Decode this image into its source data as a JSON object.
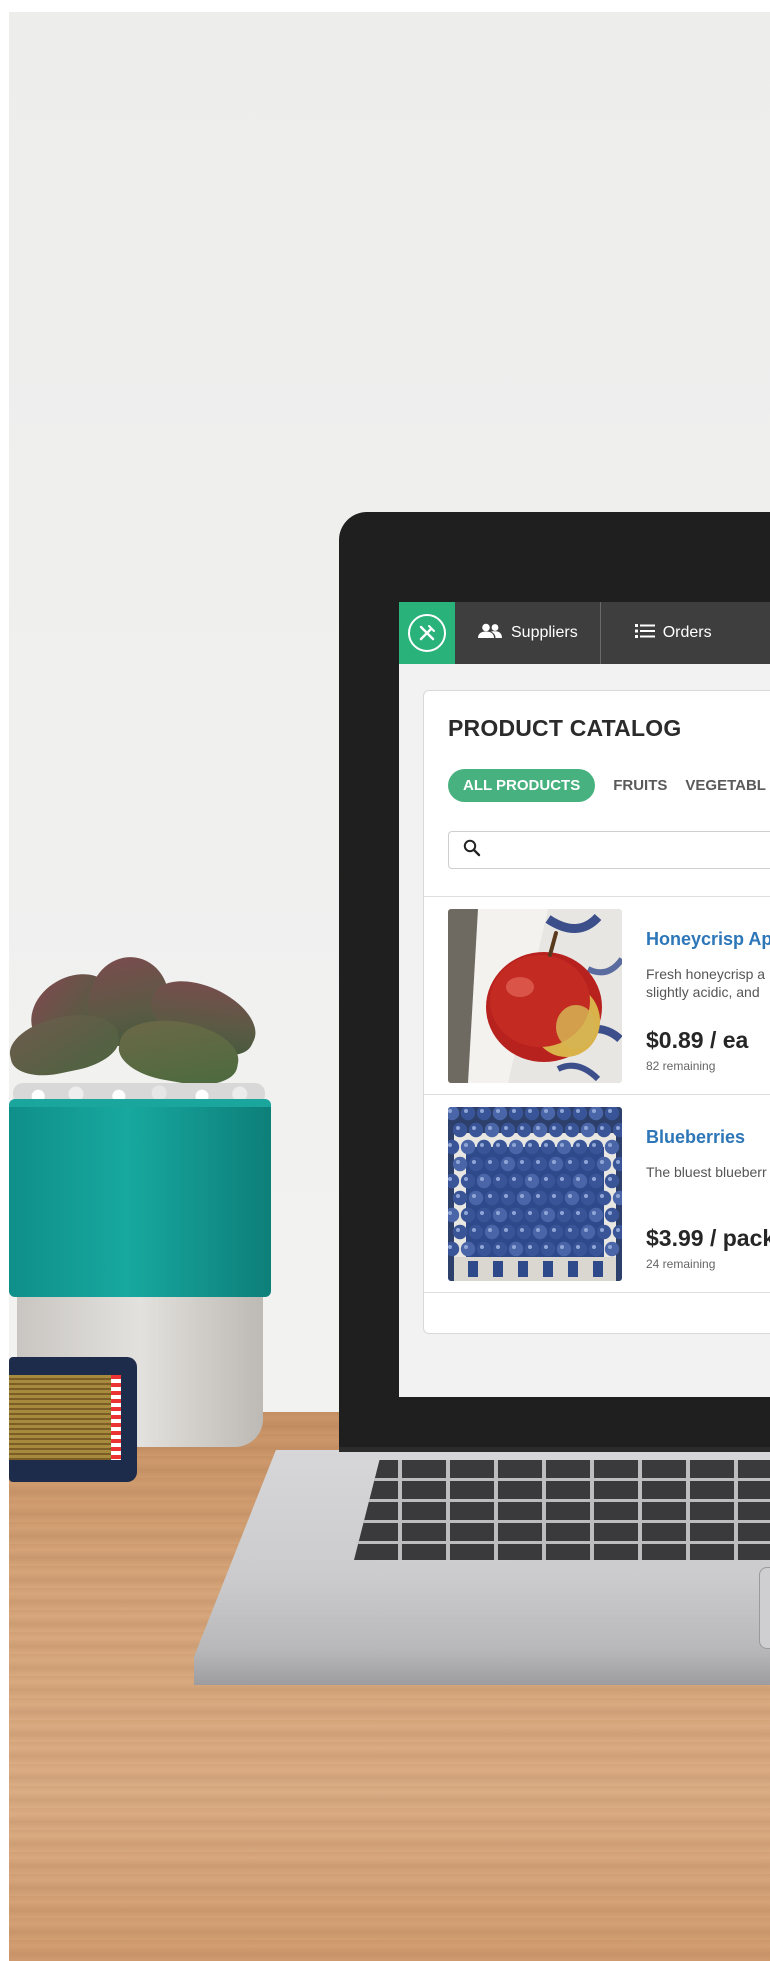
{
  "nav": {
    "suppliers_label": "Suppliers",
    "orders_label": "Orders",
    "logo_icon": "utensils-icon",
    "accent_color": "#2ab27b"
  },
  "catalog": {
    "title": "PRODUCT CATALOG",
    "filters": {
      "active": "ALL PRODUCTS",
      "fruits": "FRUITS",
      "vegetables": "VEGETABL"
    },
    "search": {
      "placeholder": "",
      "value": ""
    }
  },
  "products": [
    {
      "name": "Honeycrisp App",
      "desc_line1": "Fresh honeycrisp a",
      "desc_line2": "slightly acidic, and",
      "price": "$0.89 / ea",
      "remaining": "82 remaining",
      "image": "apple"
    },
    {
      "name": "Blueberries",
      "desc_line1": "The bluest blueberr",
      "desc_line2": "",
      "price": "$3.99 / pack",
      "remaining": "24 remaining",
      "image": "blueberries"
    }
  ]
}
